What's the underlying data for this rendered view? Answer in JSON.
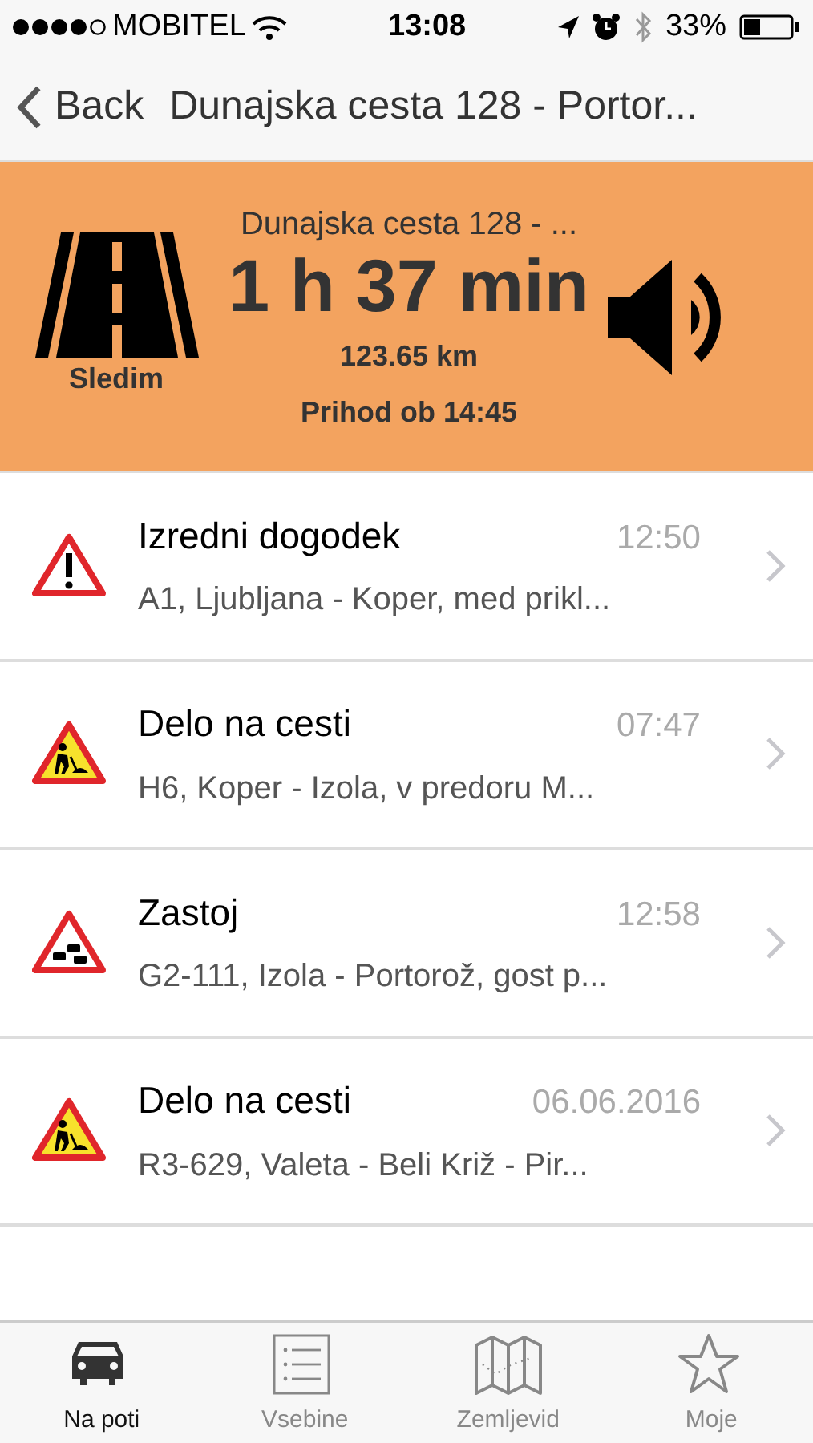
{
  "status_bar": {
    "carrier": "MOBITEL",
    "time": "13:08",
    "battery": "33%"
  },
  "nav_bar": {
    "back": "Back",
    "title": "Dunajska cesta 128 - Portor..."
  },
  "route_panel": {
    "mode": "Sledim",
    "destination": "Dunajska cesta 128 - ...",
    "duration": "1 h 37 min",
    "distance": "123.65 km",
    "arrival": "Prihod ob 14:45",
    "sound_on": true
  },
  "events": [
    {
      "kind": "incident",
      "title": "Izredni dogodek",
      "time": "12:50",
      "detail": "A1, Ljubljana - Koper, med prikl..."
    },
    {
      "kind": "roadwork",
      "title": "Delo na cesti",
      "time": "07:47",
      "detail": "H6, Koper - Izola, v predoru M..."
    },
    {
      "kind": "congestion",
      "title": "Zastoj",
      "time": "12:58",
      "detail": "G2-111, Izola - Portorož, gost p..."
    },
    {
      "kind": "roadwork",
      "title": "Delo na cesti",
      "time": "06.06.2016",
      "detail": "R3-629, Valeta - Beli Križ - Pir..."
    }
  ],
  "tab_bar": [
    {
      "kind": "car",
      "label": "Na poti",
      "selected": true
    },
    {
      "kind": "list",
      "label": "Vsebine",
      "selected": false
    },
    {
      "kind": "map",
      "label": "Zemljevid",
      "selected": false
    },
    {
      "kind": "star",
      "label": "Moje",
      "selected": false
    }
  ]
}
